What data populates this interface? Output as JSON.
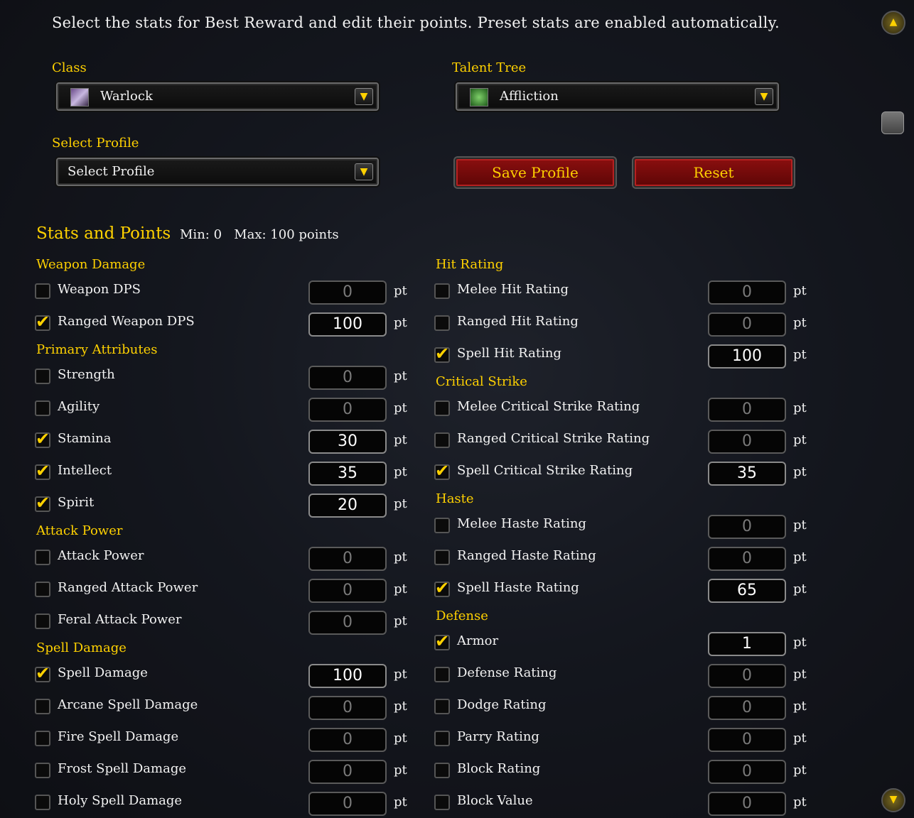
{
  "header": {
    "text": "Select the stats for Best Reward and edit their points. Preset stats are enabled automatically."
  },
  "class_field": {
    "label": "Class",
    "value": "Warlock",
    "icon": "warlock-class-icon"
  },
  "talent_field": {
    "label": "Talent Tree",
    "value": "Affliction",
    "icon": "affliction-talent-icon"
  },
  "profile_field": {
    "label": "Select Profile",
    "value": "Select Profile"
  },
  "buttons": {
    "save": "Save Profile",
    "reset": "Reset"
  },
  "stats_header": {
    "title": "Stats and Points",
    "min": "Min: 0",
    "max": "Max: 100 points"
  },
  "unit": "pt",
  "left": {
    "weapon_damage": {
      "title": "Weapon Damage",
      "items": [
        {
          "label": "Weapon DPS",
          "checked": false,
          "value": "0"
        },
        {
          "label": "Ranged Weapon DPS",
          "checked": true,
          "value": "100"
        }
      ]
    },
    "primary": {
      "title": "Primary Attributes",
      "items": [
        {
          "label": "Strength",
          "checked": false,
          "value": "0"
        },
        {
          "label": "Agility",
          "checked": false,
          "value": "0"
        },
        {
          "label": "Stamina",
          "checked": true,
          "value": "30"
        },
        {
          "label": "Intellect",
          "checked": true,
          "value": "35"
        },
        {
          "label": "Spirit",
          "checked": true,
          "value": "20"
        }
      ]
    },
    "attack_power": {
      "title": "Attack Power",
      "items": [
        {
          "label": "Attack Power",
          "checked": false,
          "value": "0"
        },
        {
          "label": "Ranged Attack Power",
          "checked": false,
          "value": "0"
        },
        {
          "label": "Feral Attack Power",
          "checked": false,
          "value": "0"
        }
      ]
    },
    "spell_damage": {
      "title": "Spell Damage",
      "items": [
        {
          "label": "Spell Damage",
          "checked": true,
          "value": "100"
        },
        {
          "label": "Arcane Spell Damage",
          "checked": false,
          "value": "0"
        },
        {
          "label": "Fire Spell Damage",
          "checked": false,
          "value": "0"
        },
        {
          "label": "Frost Spell Damage",
          "checked": false,
          "value": "0"
        },
        {
          "label": "Holy Spell Damage",
          "checked": false,
          "value": "0"
        }
      ]
    }
  },
  "right": {
    "hit": {
      "title": "Hit Rating",
      "items": [
        {
          "label": "Melee Hit Rating",
          "checked": false,
          "value": "0"
        },
        {
          "label": "Ranged Hit Rating",
          "checked": false,
          "value": "0"
        },
        {
          "label": "Spell Hit Rating",
          "checked": true,
          "value": "100"
        }
      ]
    },
    "crit": {
      "title": "Critical Strike",
      "items": [
        {
          "label": "Melee Critical Strike Rating",
          "checked": false,
          "value": "0"
        },
        {
          "label": "Ranged Critical Strike Rating",
          "checked": false,
          "value": "0"
        },
        {
          "label": "Spell Critical Strike Rating",
          "checked": true,
          "value": "35"
        }
      ]
    },
    "haste": {
      "title": "Haste",
      "items": [
        {
          "label": "Melee Haste Rating",
          "checked": false,
          "value": "0"
        },
        {
          "label": "Ranged Haste Rating",
          "checked": false,
          "value": "0"
        },
        {
          "label": "Spell Haste Rating",
          "checked": true,
          "value": "65"
        }
      ]
    },
    "defense": {
      "title": "Defense",
      "items": [
        {
          "label": "Armor",
          "checked": true,
          "value": "1"
        },
        {
          "label": "Defense Rating",
          "checked": false,
          "value": "0"
        },
        {
          "label": "Dodge Rating",
          "checked": false,
          "value": "0"
        },
        {
          "label": "Parry Rating",
          "checked": false,
          "value": "0"
        },
        {
          "label": "Block Rating",
          "checked": false,
          "value": "0"
        },
        {
          "label": "Block Value",
          "checked": false,
          "value": "0"
        }
      ]
    }
  },
  "colors": {
    "accent": "#ffd100",
    "button": "#7a0a0a"
  }
}
